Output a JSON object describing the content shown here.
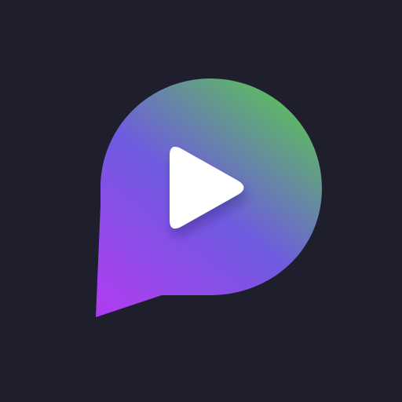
{
  "app_icon": {
    "name": "chat-bubble-play-icon",
    "colors": {
      "background": "#1f1e2d",
      "gradient_green": "#5cc05a",
      "gradient_indigo": "#6e5be0",
      "gradient_violet": "#ab3ff0",
      "play_glyph": "#ffffff"
    }
  }
}
